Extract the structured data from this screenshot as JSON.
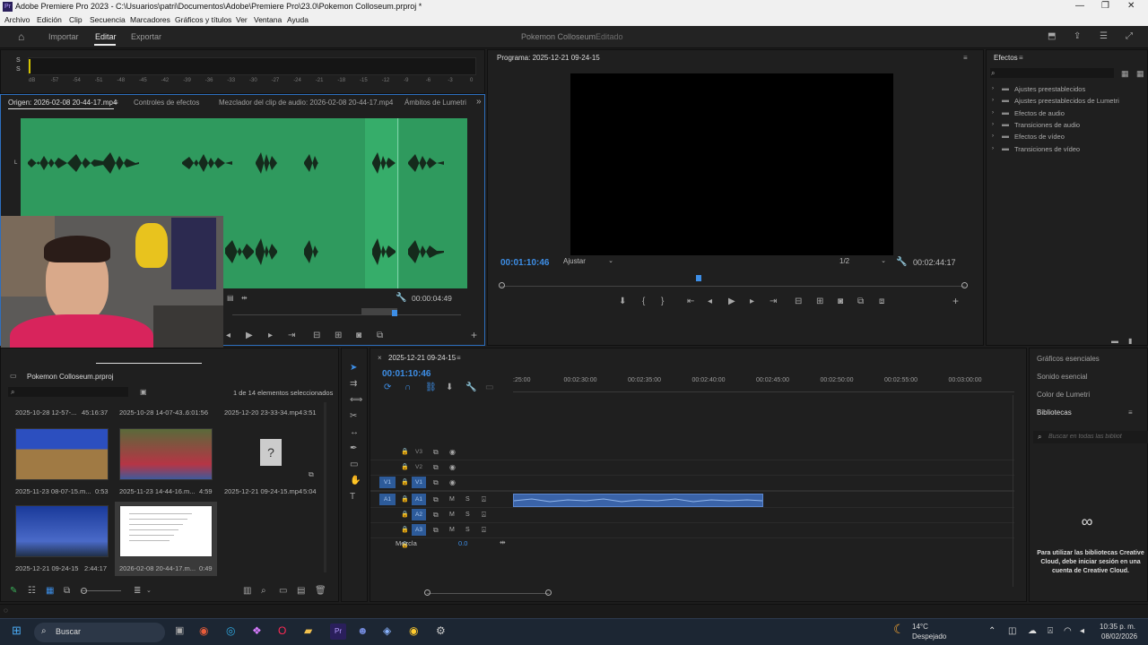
{
  "window": {
    "title": "Adobe Premiere Pro 2023 - C:\\Usuarios\\patri\\Documentos\\Adobe\\Premiere Pro\\23.0\\Pokemon Colloseum.prproj *"
  },
  "menu": [
    "Archivo",
    "Edición",
    "Clip",
    "Secuencia",
    "Marcadores",
    "Gráficos y títulos",
    "Ver",
    "Ventana",
    "Ayuda"
  ],
  "workspace": {
    "tabs": [
      "Importar",
      "Editar",
      "Exportar"
    ],
    "active": "Editar",
    "project_name": "Pokemon Colloseum",
    "status": "Editado"
  },
  "meter_ticks": [
    "dB",
    "-57",
    "-54",
    "-51",
    "-48",
    "-45",
    "-42",
    "-39",
    "-36",
    "-33",
    "-30",
    "-27",
    "-24",
    "-21",
    "-18",
    "-15",
    "-12",
    "-9",
    "-6",
    "-3",
    "0"
  ],
  "meter_labels": [
    "S",
    "S"
  ],
  "source": {
    "tabs": [
      "Origen: 2026-02-08 20-44-17.mp4",
      "Controles de efectos",
      "Mezclador del clip de audio: 2026-02-08 20-44-17.mp4",
      "Ámbitos de Lumetri"
    ],
    "timecode": "00:00:04:49",
    "channel_label": "L",
    "waveform_color": "#2f9a5e"
  },
  "program": {
    "title": "Programa: 2025-12-21 09-24-15",
    "timecode": "00:01:10:46",
    "fit": "Ajustar",
    "resolution": "1/2",
    "duration": "00:02:44:17"
  },
  "effects": {
    "title": "Efectos",
    "items": [
      "Ajustes preestablecidos",
      "Ajustes preestablecidos de Lumetri",
      "Efectos de audio",
      "Transiciones de audio",
      "Efectos de vídeo",
      "Transiciones de vídeo"
    ]
  },
  "project": {
    "title": "Pokemon Colloseum.prproj",
    "selection": "1 de 14 elementos seleccionados",
    "top_row": [
      {
        "name": "2025-10-28 12-57-...",
        "dur": "45:16:37"
      },
      {
        "name": "2025-10-28 14-07-43...",
        "dur": "6:01:56"
      },
      {
        "name": "2025-12-20 23-33-34.mp4",
        "dur": "3:51"
      }
    ],
    "clips": [
      {
        "name": "2025-11-23 08-07-15.m...",
        "dur": "0:53"
      },
      {
        "name": "2025-11-23 14-44-16.m...",
        "dur": "4:59"
      },
      {
        "name": "2025-12-21 09-24-15.mp4",
        "dur": "5:04"
      },
      {
        "name": "2025-12-21 09-24-15",
        "dur": "2:44:17"
      },
      {
        "name": "2026-02-08 20-44-17.m...",
        "dur": "0:49"
      }
    ]
  },
  "timeline": {
    "sequence": "2025-12-21 09-24-15",
    "timecode": "00:01:10:46",
    "ruler": [
      ":25:00",
      "00:02:30:00",
      "00:02:35:00",
      "00:02:40:00",
      "00:02:45:00",
      "00:02:50:00",
      "00:02:55:00",
      "00:03:00:00"
    ],
    "video_tracks": [
      "V3",
      "V2",
      "V1"
    ],
    "audio_tracks": [
      "A1",
      "A2",
      "A3"
    ],
    "source_patch": {
      "video": "V1",
      "audio": "A1"
    },
    "mix_label": "Mezcla",
    "mix_value": "0.0",
    "clip_color": "#3a63a8"
  },
  "right_panels": {
    "items": [
      "Gráficos esenciales",
      "Sonido esencial",
      "Color de Lumetri",
      "Bibliotecas"
    ],
    "search_placeholder": "Buscar en todas las bibliot",
    "cc_message": "Para utilizar las bibliotecas Creative Cloud, debe iniciar sesión en una cuenta de Creative Cloud."
  },
  "taskbar": {
    "search": "Buscar",
    "weather_temp": "14°C",
    "weather_desc": "Despejado",
    "time": "10:35 p. m.",
    "date": "08/02/2026"
  }
}
